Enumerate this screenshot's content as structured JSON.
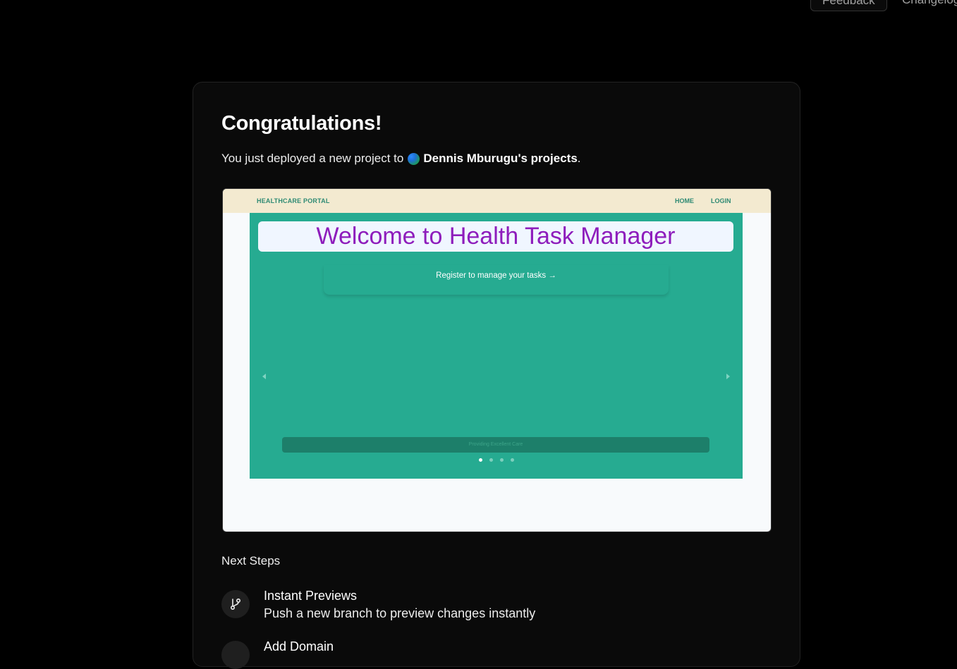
{
  "header": {
    "feedback_label": "Feedback",
    "changelog_label": "Changelog"
  },
  "card": {
    "title": "Congratulations!",
    "subtitle_prefix": "You just deployed a new project to",
    "team_name": "Dennis Mburugu's projects",
    "subtitle_suffix": "."
  },
  "preview": {
    "brand": "HEALTHCARE PORTAL",
    "nav_home": "HOME",
    "nav_login": "LOGIN",
    "welcome": "Welcome to Health Task Manager",
    "register": "Register to manage your tasks →",
    "caption": "Providing Excellent Care",
    "slide_count": 4,
    "active_slide": 1,
    "colors": {
      "nav_bg": "#f3ead0",
      "hero_bg": "#26ab91",
      "welcome_text": "#8e1dbc",
      "brand_text": "#2e8a73"
    }
  },
  "next_steps": {
    "title": "Next Steps",
    "items": [
      {
        "icon": "git-branch-icon",
        "title": "Instant Previews",
        "desc": "Push a new branch to preview changes instantly"
      },
      {
        "icon": "globe-icon",
        "title": "Add Domain",
        "desc": ""
      }
    ]
  }
}
